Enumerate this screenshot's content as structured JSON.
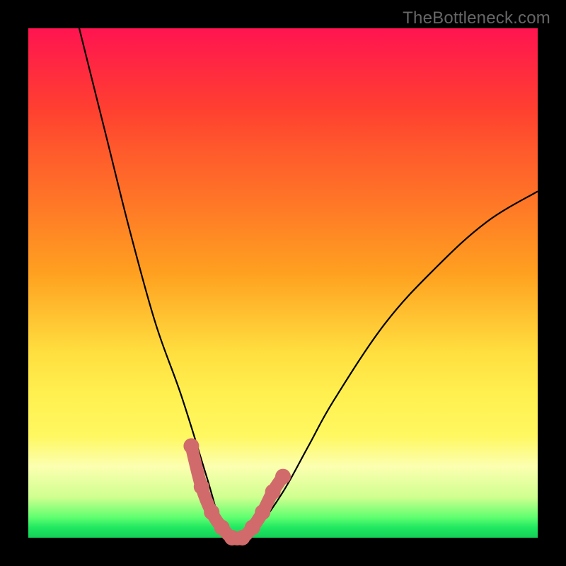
{
  "watermark": "TheBottleneck.com",
  "chart_data": {
    "type": "line",
    "title": "",
    "xlabel": "",
    "ylabel": "",
    "xlim": [
      0,
      100
    ],
    "ylim": [
      0,
      100
    ],
    "gradient_note": "Background is a vertical gradient from red (top, high bottleneck) through orange/yellow to green (bottom, no bottleneck).",
    "series": [
      {
        "name": "bottleneck-curve",
        "color": "#000000",
        "x": [
          10,
          15,
          20,
          25,
          30,
          35,
          38,
          40,
          42,
          45,
          50,
          55,
          60,
          70,
          80,
          90,
          100
        ],
        "values": [
          100,
          80,
          60,
          42,
          28,
          12,
          2,
          0,
          0,
          2,
          9,
          18,
          27,
          42,
          53,
          62,
          68
        ]
      }
    ],
    "markers": {
      "name": "highlight-points",
      "color": "#d16b6b",
      "x": [
        32,
        34,
        36,
        38,
        40,
        42,
        44,
        46,
        48,
        50
      ],
      "values": [
        18,
        10,
        5,
        2,
        0,
        0,
        2,
        5,
        9,
        12
      ]
    }
  }
}
